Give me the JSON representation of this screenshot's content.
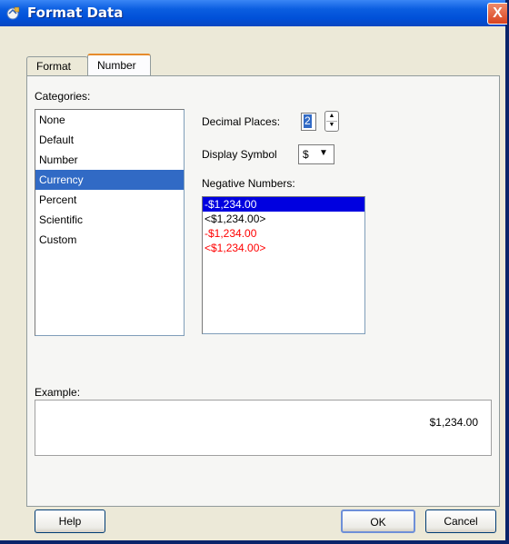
{
  "window": {
    "title": "Format Data",
    "close_glyph": "X",
    "icon": "app-icon"
  },
  "tabs": [
    {
      "label": "Format",
      "active": false
    },
    {
      "label": "Number",
      "active": true
    }
  ],
  "categories": {
    "label": "Categories:",
    "items": [
      "None",
      "Default",
      "Number",
      "Currency",
      "Percent",
      "Scientific",
      "Custom"
    ],
    "selected": "Currency"
  },
  "decimal_places": {
    "label": "Decimal Places:",
    "value": "2"
  },
  "display_symbol": {
    "label": "Display Symbol",
    "value": "$"
  },
  "negative_numbers": {
    "label": "Negative Numbers:",
    "items": [
      "-$1,234.00",
      "<$1,234.00>",
      "-$1,234.00",
      "<$1,234.00>"
    ],
    "selected_index": 0,
    "red_items": [
      2,
      3
    ]
  },
  "example": {
    "label": "Example:",
    "value": "$1,234.00"
  },
  "buttons": {
    "help": "Help",
    "ok": "OK",
    "cancel": "Cancel"
  },
  "colors": {
    "title_bar": "#0054e3",
    "selected": "#316ac5",
    "negative_red": "#ff0000"
  }
}
